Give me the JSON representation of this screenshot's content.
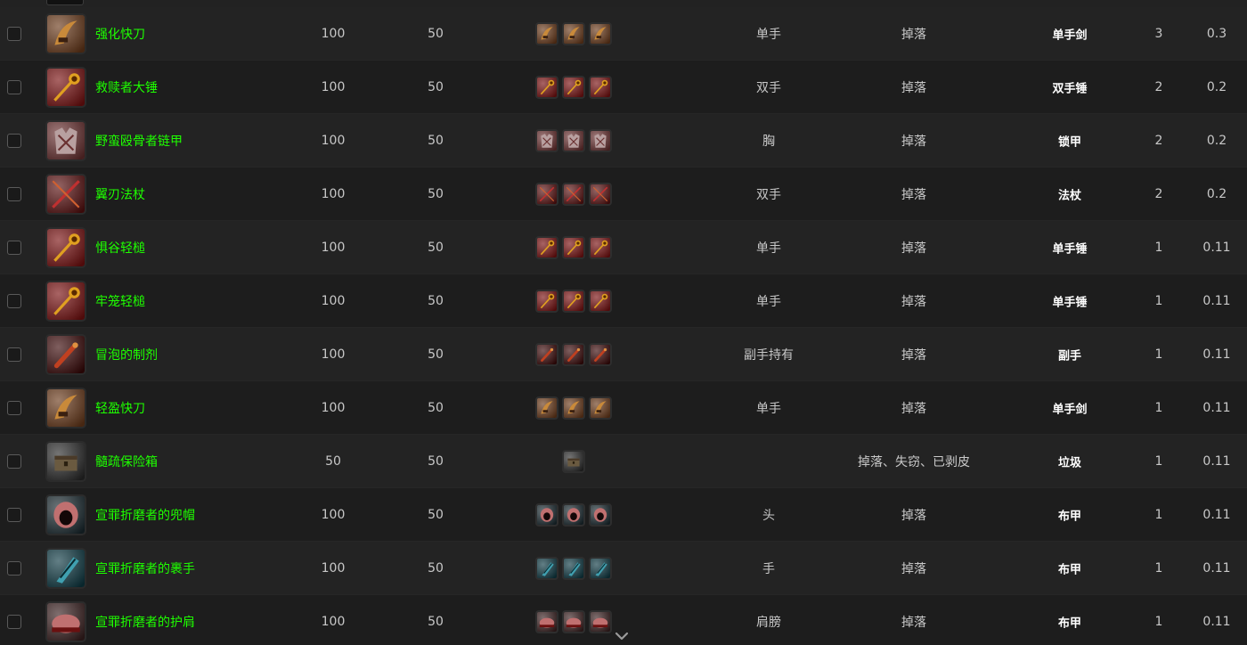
{
  "rows": [
    {
      "name": "强化快刀",
      "ilvl": "100",
      "req": "50",
      "slot": "单手",
      "source": "掉落",
      "type": "单手剑",
      "count": "3",
      "pct": "0.3",
      "icon": "curved-blade-icon",
      "variants": 3,
      "colors": [
        "#6b3a1a",
        "#c98a3a"
      ]
    },
    {
      "name": "救赎者大锤",
      "ilvl": "100",
      "req": "50",
      "slot": "双手",
      "source": "掉落",
      "type": "双手锤",
      "count": "2",
      "pct": "0.2",
      "icon": "mace-icon",
      "variants": 3,
      "colors": [
        "#7a1010",
        "#e0a020"
      ]
    },
    {
      "name": "野蛮殴骨者链甲",
      "ilvl": "100",
      "req": "50",
      "slot": "胸",
      "source": "掉落",
      "type": "锁甲",
      "count": "2",
      "pct": "0.2",
      "icon": "chest-armor-icon",
      "variants": 3,
      "colors": [
        "#6a3030",
        "#b8a0a0"
      ]
    },
    {
      "name": "翼刃法杖",
      "ilvl": "100",
      "req": "50",
      "slot": "双手",
      "source": "掉落",
      "type": "法杖",
      "count": "2",
      "pct": "0.2",
      "icon": "staff-icon",
      "variants": 3,
      "colors": [
        "#5a1010",
        "#c03030"
      ]
    },
    {
      "name": "惧谷轻槌",
      "ilvl": "100",
      "req": "50",
      "slot": "单手",
      "source": "掉落",
      "type": "单手锤",
      "count": "1",
      "pct": "0.11",
      "icon": "mace-icon",
      "variants": 3,
      "colors": [
        "#7a1010",
        "#e0a020"
      ]
    },
    {
      "name": "牢笼轻槌",
      "ilvl": "100",
      "req": "50",
      "slot": "单手",
      "source": "掉落",
      "type": "单手锤",
      "count": "1",
      "pct": "0.11",
      "icon": "mace-icon",
      "variants": 3,
      "colors": [
        "#7a1010",
        "#e0a020"
      ]
    },
    {
      "name": "冒泡的制剂",
      "ilvl": "100",
      "req": "50",
      "slot": "副手持有",
      "source": "掉落",
      "type": "副手",
      "count": "1",
      "pct": "0.11",
      "icon": "vial-icon",
      "variants": 3,
      "colors": [
        "#3a0808",
        "#c04020"
      ]
    },
    {
      "name": "轻盈快刀",
      "ilvl": "100",
      "req": "50",
      "slot": "单手",
      "source": "掉落",
      "type": "单手剑",
      "count": "1",
      "pct": "0.11",
      "icon": "curved-blade-icon",
      "variants": 3,
      "colors": [
        "#6b3a1a",
        "#c98a3a"
      ]
    },
    {
      "name": "髓疏保险箱",
      "ilvl": "50",
      "req": "50",
      "slot": "",
      "source": "掉落、失窃、已剥皮",
      "type": "垃圾",
      "count": "1",
      "pct": "0.11",
      "icon": "lockbox-icon",
      "variants": 1,
      "colors": [
        "#2a2a2a",
        "#6a5a40"
      ]
    },
    {
      "name": "宣罪折磨者的兜帽",
      "ilvl": "100",
      "req": "50",
      "slot": "头",
      "source": "掉落",
      "type": "布甲",
      "count": "1",
      "pct": "0.11",
      "icon": "hood-icon",
      "variants": 3,
      "colors": [
        "#1a2a30",
        "#c07070"
      ]
    },
    {
      "name": "宣罪折磨者的裹手",
      "ilvl": "100",
      "req": "50",
      "slot": "手",
      "source": "掉落",
      "type": "布甲",
      "count": "1",
      "pct": "0.11",
      "icon": "gloves-icon",
      "variants": 3,
      "colors": [
        "#0e3a44",
        "#40a0b0"
      ]
    },
    {
      "name": "宣罪折磨者的护肩",
      "ilvl": "100",
      "req": "50",
      "slot": "肩膀",
      "source": "掉落",
      "type": "布甲",
      "count": "1",
      "pct": "0.11",
      "icon": "shoulder-icon",
      "variants": 3,
      "colors": [
        "#3a2020",
        "#c07070"
      ]
    }
  ],
  "scroll_indicator": "chevron-down-icon"
}
